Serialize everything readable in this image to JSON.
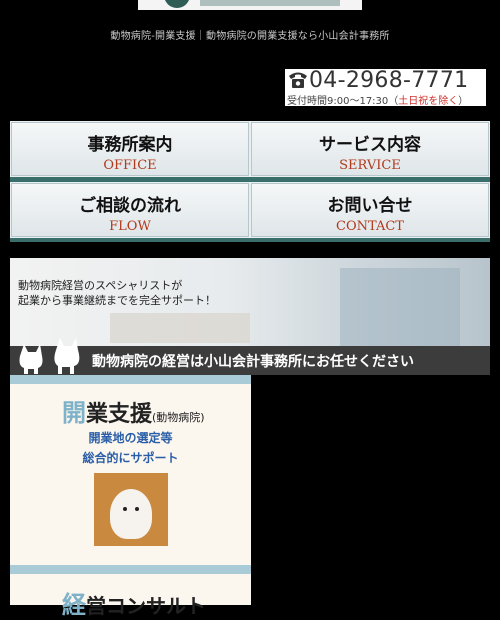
{
  "header": {
    "tagline": "動物病院-開業支援｜動物病院の開業支援なら小山会計事務所"
  },
  "contact": {
    "phone": "04-2968-7771",
    "hours_prefix": "受付時間9:00〜17:30（",
    "hours_highlight": "土日祝を除く",
    "hours_suffix": "）"
  },
  "nav": {
    "items": [
      {
        "jp": "事務所案内",
        "en": "OFFICE"
      },
      {
        "jp": "サービス内容",
        "en": "SERVICE"
      },
      {
        "jp": "ご相談の流れ",
        "en": "FLOW"
      },
      {
        "jp": "お問い合せ",
        "en": "CONTACT"
      }
    ]
  },
  "banner": {
    "line1": "動物病院経営のスペシャリストが",
    "line2": "起業から事業継続までを完全サポート！",
    "caption": "動物病院の経営は小山会計事務所にお任せください"
  },
  "cards": [
    {
      "title_first": "開",
      "title_rest": "業支援",
      "title_note": "(動物病院)",
      "sub1": "開業地の選定等",
      "sub2": "総合的にサポート"
    },
    {
      "title_first": "経",
      "title_rest": "営コンサルト"
    }
  ],
  "colors": {
    "accent_teal": "#3a6e6a",
    "nav_en_red": "#b23a1c",
    "link_blue": "#2a5ea8"
  }
}
